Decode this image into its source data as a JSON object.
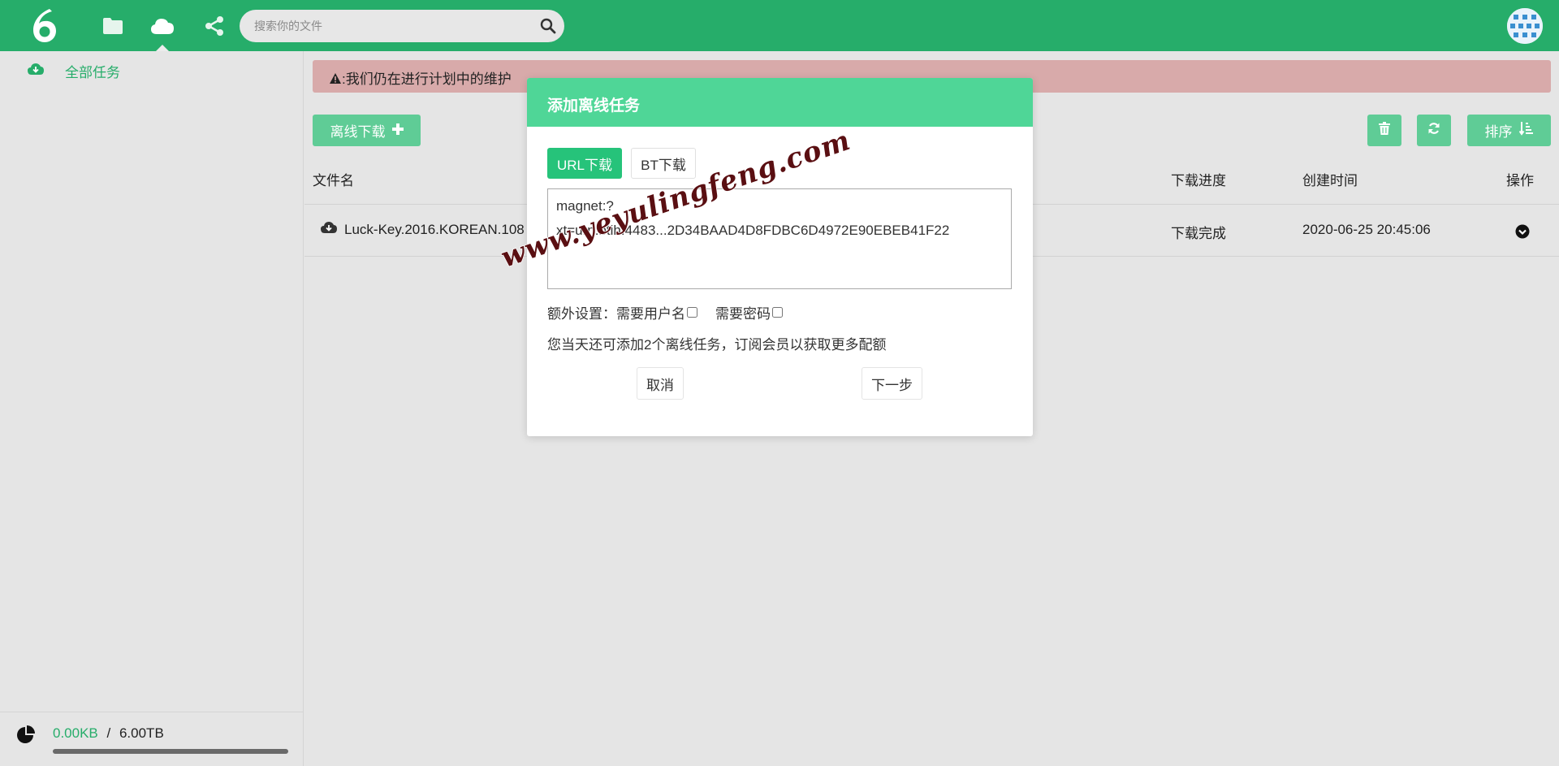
{
  "topbar": {
    "logo_text": "6",
    "search_placeholder": "搜索你的文件",
    "nav_icons": [
      "folder-icon",
      "cloud-icon",
      "share-icon"
    ],
    "active_nav": "cloud-icon"
  },
  "sidebar": {
    "items": [
      {
        "label": "全部任务",
        "icon": "cloud-download-icon",
        "active": true
      }
    ],
    "storage": {
      "used": "0.00KB",
      "separator": "/",
      "total": "6.00TB",
      "used_fraction": 0.0
    }
  },
  "main": {
    "notice": ":我们仍在进行计划中的维护",
    "offline_button": "离线下载",
    "sort_button": "排序",
    "columns": {
      "name": "文件名",
      "progress": "下载进度",
      "created": "创建时间",
      "action": "操作"
    },
    "rows": [
      {
        "name": "Luck-Key.2016.KOREAN.108",
        "progress": "下载完成",
        "created": "2020-06-25 20:45:06"
      }
    ]
  },
  "modal": {
    "title": "添加离线任务",
    "tab_url": "URL下载",
    "tab_bt": "BT下载",
    "url_value": "magnet:?\nxt=urn:btih:4483...2D34BAAD4D8FDBC6D4972E90EBEB41F22",
    "options_label": "额外设置：",
    "opt_username": "需要用户名",
    "opt_password": "需要密码",
    "quota": "您当天还可添加2个离线任务，订阅会员以获取更多配额",
    "cancel": "取消",
    "next": "下一步"
  },
  "watermark": "www.yeyulingfeng.com",
  "colors": {
    "brand": "#26ad6a",
    "modal_header": "#4fd697",
    "notice_bg": "#d8aaaa"
  }
}
